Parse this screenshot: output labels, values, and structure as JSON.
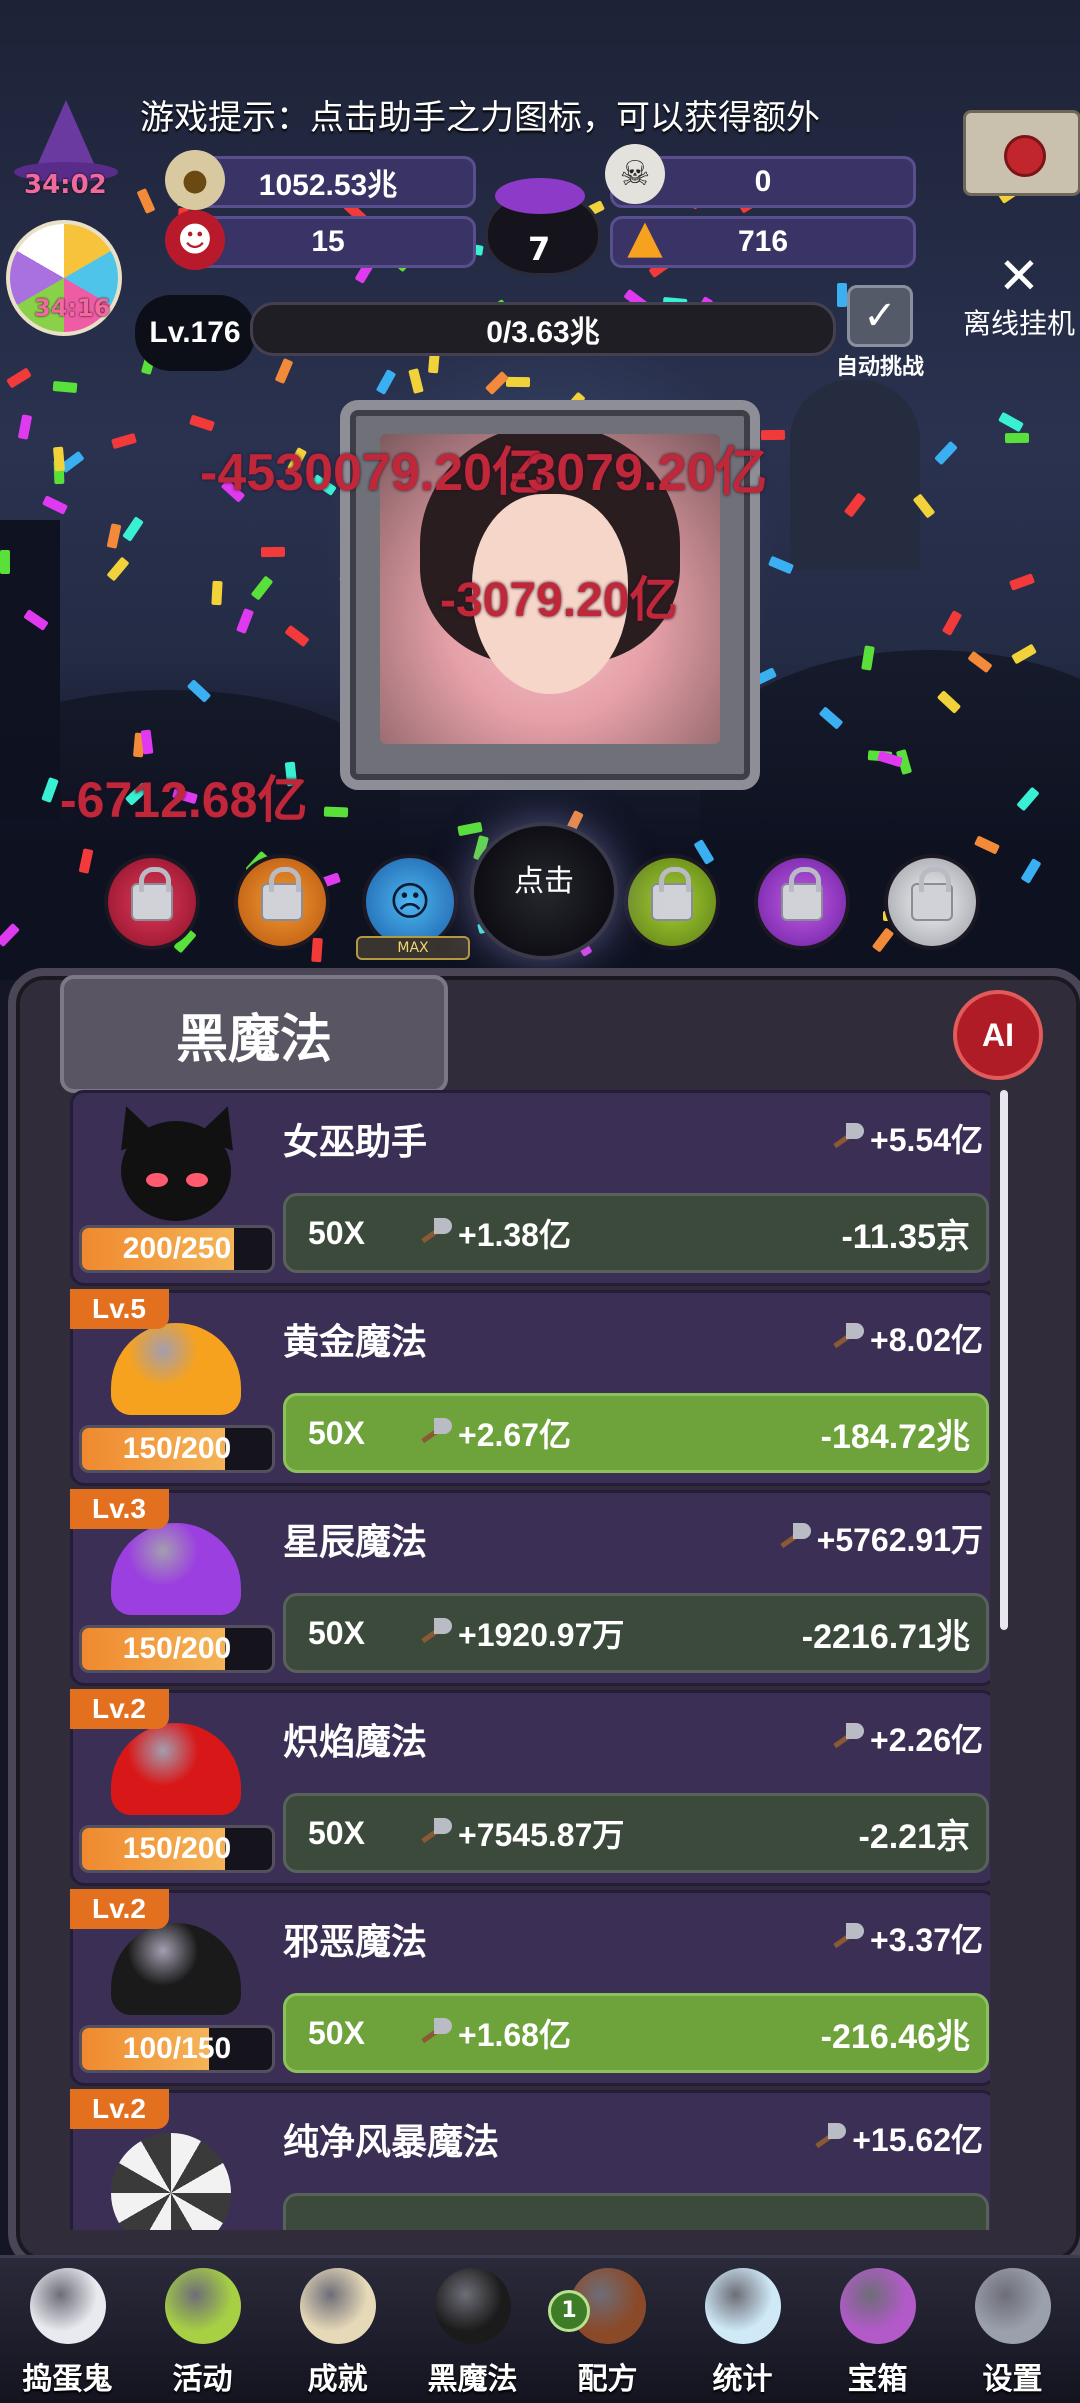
{
  "hud": {
    "tip": "游戏提示：点击助手之力图标，可以获得额外",
    "hat_timer": "34:02",
    "candy_timer": "34:16",
    "gold": "1052.53兆",
    "skulls": "0",
    "candy_count": "15",
    "corn_count": "716",
    "cauldron_num": "7",
    "level": "Lv.176",
    "progress_text": "0/3.63兆",
    "auto_label": "自动挑战",
    "offline_label": "离线挂机"
  },
  "damage_numbers": [
    "-4530079.20亿",
    "-3079.20亿",
    "-3079.20亿",
    "-6712.68亿"
  ],
  "center_orb_label": "点击",
  "max_label": "MAX",
  "panel": {
    "title": "黑魔法",
    "ai_label": "AI"
  },
  "spells": [
    {
      "name": "女巫助手",
      "dps": "+5.54亿",
      "mult": "50X",
      "inc": "+1.38亿",
      "cost": "-11.35京",
      "count": "200/250",
      "fill": 0.8,
      "lv": "",
      "affordable": false,
      "icon": "devil-cat-icon"
    },
    {
      "name": "黄金魔法",
      "dps": "+8.02亿",
      "mult": "50X",
      "inc": "+2.67亿",
      "cost": "-184.72兆",
      "count": "150/200",
      "fill": 0.75,
      "lv": "Lv.5",
      "affordable": true,
      "icon": "gold-dome-icon",
      "color": "#f6a21e"
    },
    {
      "name": "星辰魔法",
      "dps": "+5762.91万",
      "mult": "50X",
      "inc": "+1920.97万",
      "cost": "-2216.71兆",
      "count": "150/200",
      "fill": 0.75,
      "lv": "Lv.3",
      "affordable": false,
      "icon": "purple-dome-icon",
      "color": "#9b3fe0"
    },
    {
      "name": "炽焰魔法",
      "dps": "+2.26亿",
      "mult": "50X",
      "inc": "+7545.87万",
      "cost": "-2.21京",
      "count": "150/200",
      "fill": 0.75,
      "lv": "Lv.2",
      "affordable": false,
      "icon": "red-dome-icon",
      "color": "#d81818"
    },
    {
      "name": "邪恶魔法",
      "dps": "+3.37亿",
      "mult": "50X",
      "inc": "+1.68亿",
      "cost": "-216.46兆",
      "count": "100/150",
      "fill": 0.67,
      "lv": "Lv.2",
      "affordable": true,
      "icon": "black-dome-icon",
      "color": "#1a1a1a"
    },
    {
      "name": "纯净风暴魔法",
      "dps": "+15.62亿",
      "mult": "",
      "inc": "",
      "cost": "",
      "count": "",
      "fill": 0,
      "lv": "Lv.2",
      "affordable": false,
      "icon": "storm-swirl-icon",
      "color": "#e8e8e8"
    }
  ],
  "nav": [
    {
      "label": "捣蛋鬼",
      "icon": "ghost-icon",
      "color": "#e9e9f0"
    },
    {
      "label": "活动",
      "icon": "eyeballs-icon",
      "color": "#a7d044"
    },
    {
      "label": "成就",
      "icon": "skull-trophy-icon",
      "color": "#e6d9b8"
    },
    {
      "label": "黑魔法",
      "icon": "devil-cat-icon",
      "color": "#1b1b1b"
    },
    {
      "label": "配方",
      "icon": "recipe-book-icon",
      "color": "#8a4a2a",
      "badge": "1"
    },
    {
      "label": "统计",
      "icon": "crystal-ball-icon",
      "color": "#cfe9f7"
    },
    {
      "label": "宝箱",
      "icon": "chest-icon",
      "color": "#b35ac9"
    },
    {
      "label": "设置",
      "icon": "gear-icon",
      "color": "#9aa0ac"
    }
  ]
}
